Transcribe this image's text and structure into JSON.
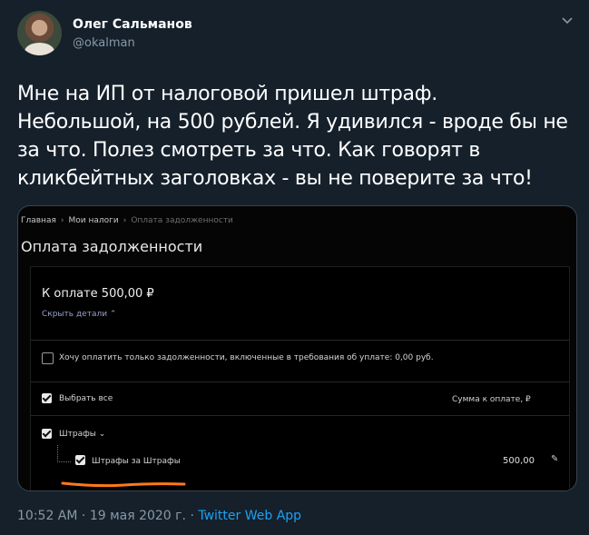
{
  "author": {
    "name": "Олег Сальманов",
    "handle": "@okalman"
  },
  "tweet": {
    "lines": [
      "Мне на ИП от налоговой пришел штраф.",
      "Небольшой, на 500 рублей. Я удивился - вроде бы не",
      "за что. Полез смотреть за что. Как говорят в",
      "кликбейтных заголовках - вы не поверите за что!"
    ]
  },
  "screenshot": {
    "breadcrumb": [
      "Главная",
      "Мои налоги",
      "Оплата задолженности"
    ],
    "page_title": "Оплата задолженности",
    "amount_label": "К оплате 500,00 ₽",
    "hide_details": "Скрыть детали ⌃",
    "only_requirements": {
      "label": "Хочу оплатить только задолженности, включенные в требования об уплате: 0,00 руб.",
      "checked": false
    },
    "select_all": {
      "label": "Выбрать все",
      "checked": true
    },
    "sum_column": "Сумма к оплате, ₽",
    "group": {
      "label": "Штрафы ⌄",
      "checked": true
    },
    "item": {
      "label": "Штрафы за Штрафы",
      "checked": true,
      "value": "500,00"
    },
    "highlight_color": "#ff7a1a"
  },
  "footer": {
    "time": "10:52 AM",
    "date": "19 мая 2020 г.",
    "separator": "·",
    "source": "Twitter Web App"
  }
}
